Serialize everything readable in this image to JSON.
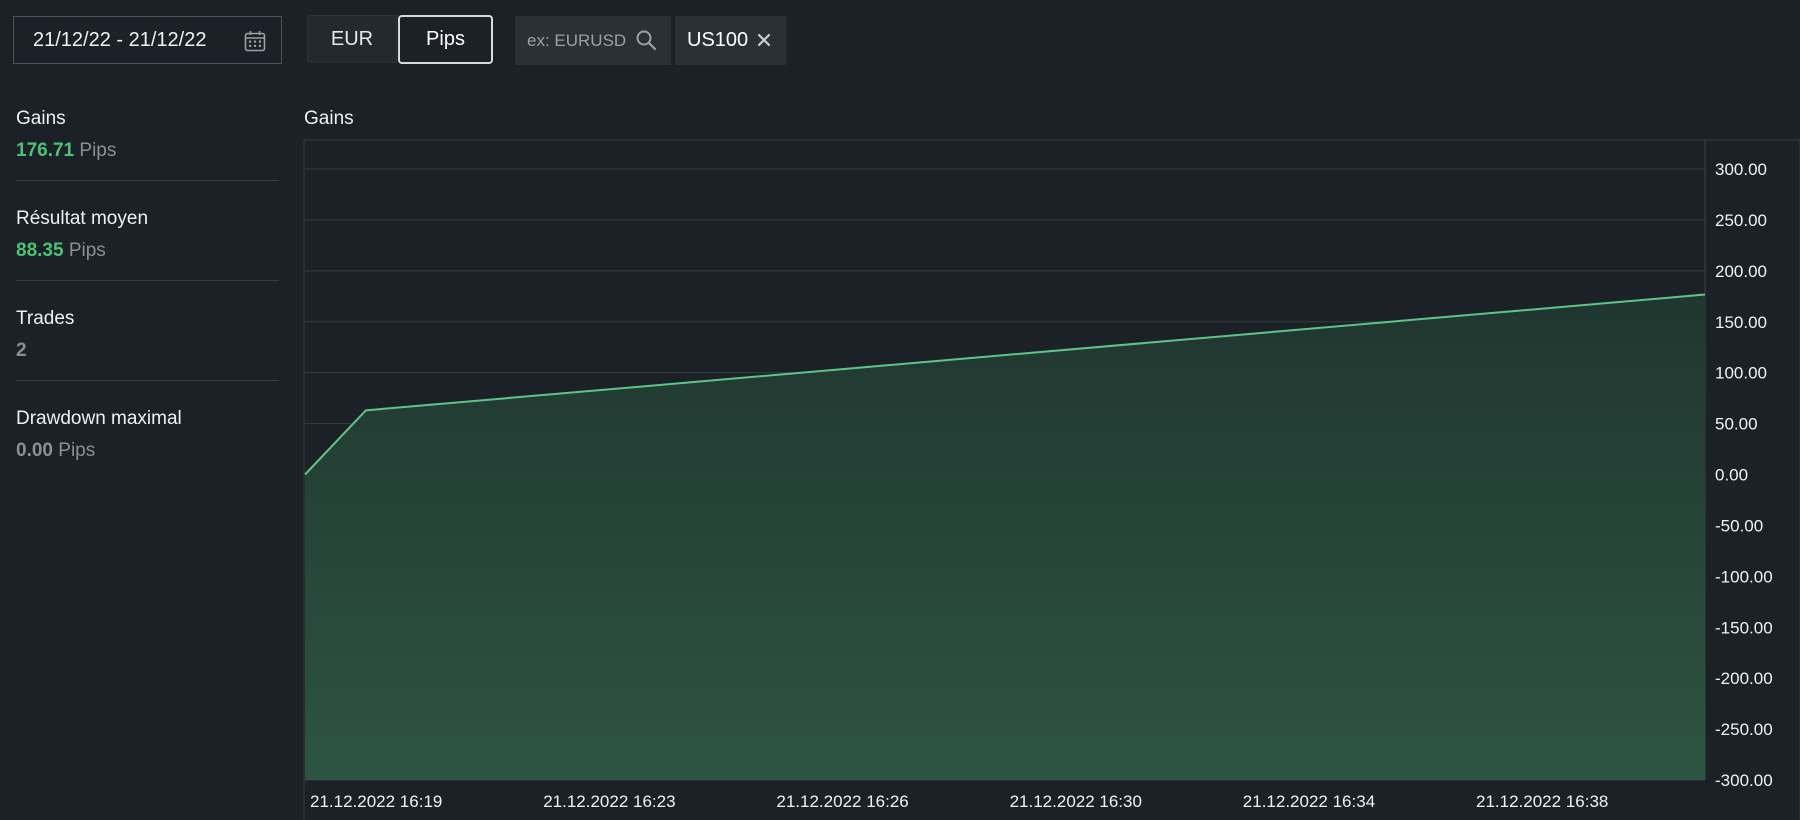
{
  "toolbar": {
    "date_range": "21/12/22 - 21/12/22",
    "unit_options": [
      "EUR",
      "Pips"
    ],
    "unit_selected": "Pips",
    "search_placeholder": "ex: EURUSD",
    "symbol_chip": "US100"
  },
  "stats": [
    {
      "label": "Gains",
      "value": "176.71",
      "unit": "Pips",
      "tone": "green"
    },
    {
      "label": "Résultat moyen",
      "value": "88.35",
      "unit": "Pips",
      "tone": "green"
    },
    {
      "label": "Trades",
      "value": "2",
      "unit": "",
      "tone": "grey"
    },
    {
      "label": "Drawdown maximal",
      "value": "0.00",
      "unit": "Pips",
      "tone": "grey"
    }
  ],
  "colors": {
    "background": "#1b2126",
    "positive": "#4cc277",
    "line": "#5fc48a",
    "area": "#2d5442"
  },
  "chart_data": {
    "type": "area",
    "title": "Gains",
    "x": [
      "21.12.2022 16:17",
      "21.12.2022 16:18",
      "21.12.2022 16:40"
    ],
    "y": [
      0,
      63,
      176.71
    ],
    "x_tick_labels": [
      "21.12.2022 16:19",
      "21.12.2022 16:23",
      "21.12.2022 16:26",
      "21.12.2022 16:30",
      "21.12.2022 16:34",
      "21.12.2022 16:38"
    ],
    "y_tick_labels": [
      "300.00",
      "250.00",
      "200.00",
      "150.00",
      "100.00",
      "50.00",
      "0.00",
      "-50.00",
      "-100.00",
      "-150.00",
      "-200.00",
      "-250.00",
      "-300.00"
    ],
    "ylim": [
      -300,
      300
    ],
    "grid": true,
    "y_axis_side": "right"
  }
}
